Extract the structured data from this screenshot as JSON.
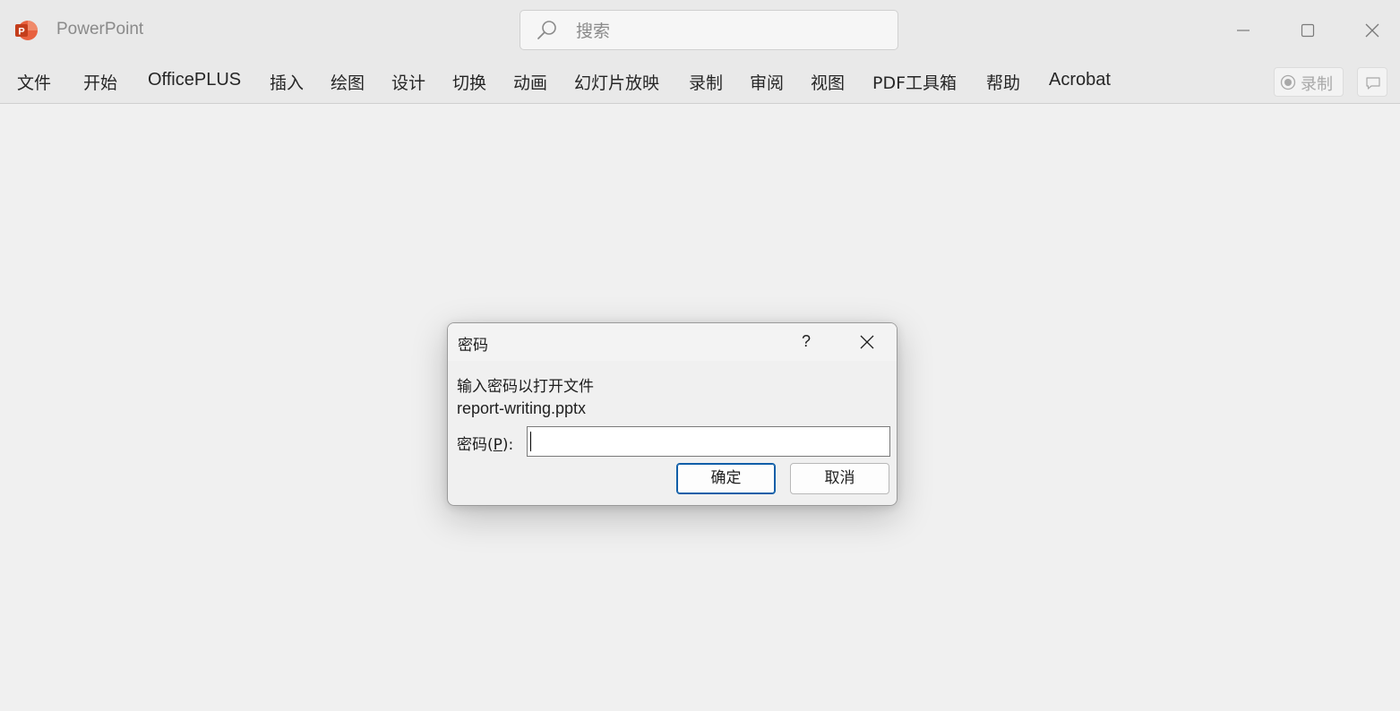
{
  "window": {
    "app_name": "PowerPoint",
    "logo_letter": "P"
  },
  "search": {
    "placeholder": "搜索"
  },
  "ribbon": {
    "tabs": [
      {
        "label": "文件"
      },
      {
        "label": "开始"
      },
      {
        "label": "OfficePLUS"
      },
      {
        "label": "插入"
      },
      {
        "label": "绘图"
      },
      {
        "label": "设计"
      },
      {
        "label": "切换"
      },
      {
        "label": "动画"
      },
      {
        "label": "幻灯片放映"
      },
      {
        "label": "录制"
      },
      {
        "label": "审阅"
      },
      {
        "label": "视图"
      },
      {
        "label": "PDF工具箱"
      },
      {
        "label": "帮助"
      },
      {
        "label": "Acrobat"
      }
    ],
    "record_label": "录制"
  },
  "dialog": {
    "title": "密码",
    "help_label": "?",
    "prompt": "输入密码以打开文件",
    "file_name": "report-writing.pptx",
    "password_label_prefix": "密码(",
    "password_label_key": "P",
    "password_label_suffix": "):",
    "password_value": "",
    "ok_label": "确定",
    "cancel_label": "取消"
  },
  "colors": {
    "brand": "#c43e1c",
    "accent": "#0f5ea8"
  }
}
